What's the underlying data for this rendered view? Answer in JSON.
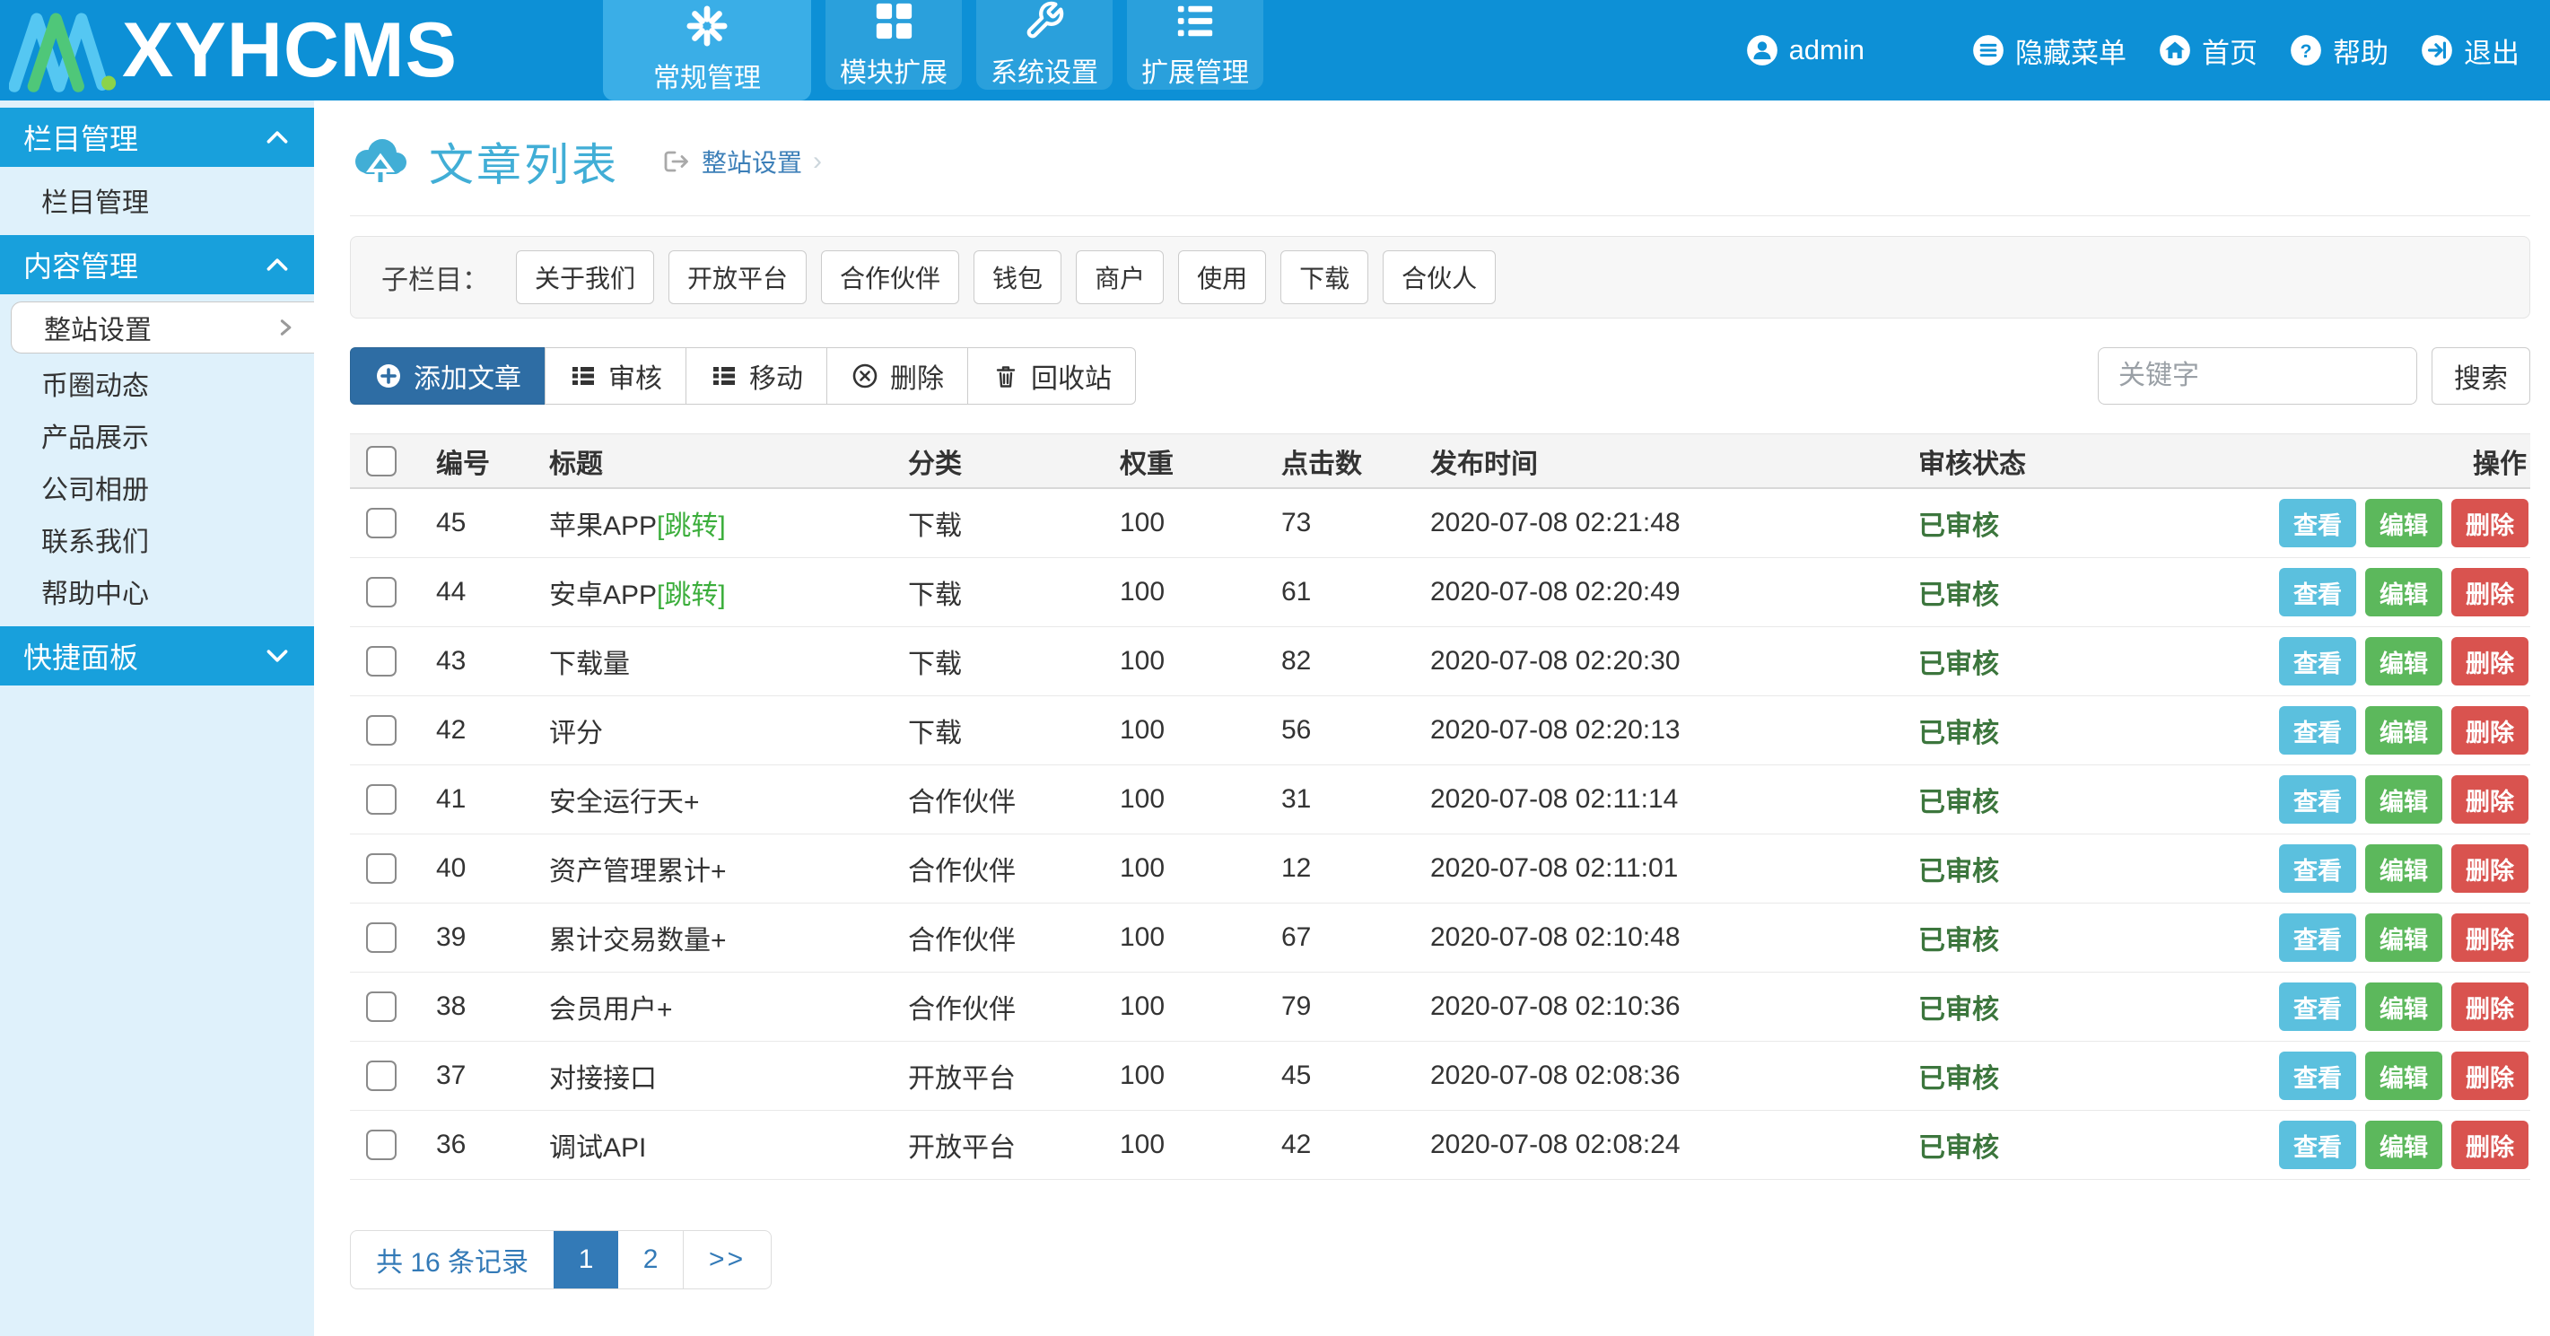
{
  "header": {
    "logo_text": "XYHCMS",
    "nav": [
      {
        "label": "常规管理",
        "icon": "asterisk-icon",
        "active": true
      },
      {
        "label": "模块扩展",
        "icon": "grid-icon",
        "active": false
      },
      {
        "label": "系统设置",
        "icon": "wrench-icon",
        "active": false
      },
      {
        "label": "扩展管理",
        "icon": "list-icon",
        "active": false
      }
    ],
    "user_name": "admin",
    "links": [
      {
        "label": "隐藏菜单",
        "icon": "menu-list-icon"
      },
      {
        "label": "首页",
        "icon": "home-icon"
      },
      {
        "label": "帮助",
        "icon": "help-icon"
      },
      {
        "label": "退出",
        "icon": "logout-icon"
      }
    ]
  },
  "sidebar": {
    "sections": [
      {
        "title": "栏目管理",
        "state": "expanded"
      },
      {
        "title": "内容管理",
        "state": "expanded"
      },
      {
        "title": "快捷面板",
        "state": "collapsed"
      }
    ],
    "column_items": [
      "栏目管理"
    ],
    "active_item": "整站设置",
    "content_items": [
      "币圈动态",
      "产品展示",
      "公司相册",
      "联系我们",
      "帮助中心"
    ]
  },
  "page": {
    "title": "文章列表",
    "breadcrumb": "整站设置",
    "breadcrumb_chevron": "›",
    "subcolumns_label": "子栏目：",
    "subcolumns": [
      "关于我们",
      "开放平台",
      "合作伙伴",
      "钱包",
      "商户",
      "使用",
      "下载",
      "合伙人"
    ],
    "toolbar": {
      "add": "添加文章",
      "review": "审核",
      "move": "移动",
      "remove": "删除",
      "recycle": "回收站"
    },
    "search": {
      "placeholder": "关键字",
      "button": "搜索"
    }
  },
  "table": {
    "columns": {
      "id": "编号",
      "title": "标题",
      "category": "分类",
      "weight": "权重",
      "clicks": "点击数",
      "time": "发布时间",
      "status": "审核状态",
      "ops": "操作"
    },
    "actions": {
      "view": "查看",
      "edit": "编辑",
      "del": "删除"
    },
    "rows": [
      {
        "id": "45",
        "title": "苹果APP",
        "jump": "[跳转]",
        "category": "下载",
        "weight": "100",
        "clicks": "73",
        "time": "2020-07-08 02:21:48",
        "status": "已审核"
      },
      {
        "id": "44",
        "title": "安卓APP",
        "jump": "[跳转]",
        "category": "下载",
        "weight": "100",
        "clicks": "61",
        "time": "2020-07-08 02:20:49",
        "status": "已审核"
      },
      {
        "id": "43",
        "title": "下载量",
        "category": "下载",
        "weight": "100",
        "clicks": "82",
        "time": "2020-07-08 02:20:30",
        "status": "已审核"
      },
      {
        "id": "42",
        "title": "评分",
        "category": "下载",
        "weight": "100",
        "clicks": "56",
        "time": "2020-07-08 02:20:13",
        "status": "已审核"
      },
      {
        "id": "41",
        "title": "安全运行天+",
        "category": "合作伙伴",
        "weight": "100",
        "clicks": "31",
        "time": "2020-07-08 02:11:14",
        "status": "已审核"
      },
      {
        "id": "40",
        "title": "资产管理累计+",
        "category": "合作伙伴",
        "weight": "100",
        "clicks": "12",
        "time": "2020-07-08 02:11:01",
        "status": "已审核"
      },
      {
        "id": "39",
        "title": "累计交易数量+",
        "category": "合作伙伴",
        "weight": "100",
        "clicks": "67",
        "time": "2020-07-08 02:10:48",
        "status": "已审核"
      },
      {
        "id": "38",
        "title": "会员用户+",
        "category": "合作伙伴",
        "weight": "100",
        "clicks": "79",
        "time": "2020-07-08 02:10:36",
        "status": "已审核"
      },
      {
        "id": "37",
        "title": "对接接口",
        "category": "开放平台",
        "weight": "100",
        "clicks": "45",
        "time": "2020-07-08 02:08:36",
        "status": "已审核"
      },
      {
        "id": "36",
        "title": "调试API",
        "category": "开放平台",
        "weight": "100",
        "clicks": "42",
        "time": "2020-07-08 02:08:24",
        "status": "已审核"
      }
    ]
  },
  "pagination": {
    "total": "共 16 条记录",
    "page1": "1",
    "page2": "2",
    "next": ">>"
  }
}
